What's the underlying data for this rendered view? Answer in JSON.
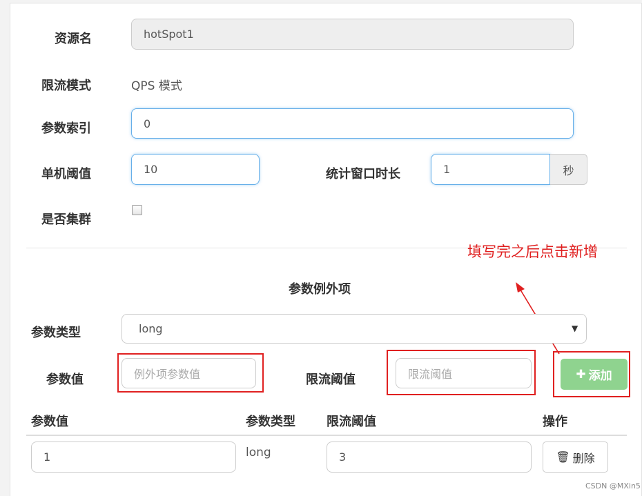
{
  "form": {
    "resource_label": "资源名",
    "resource_value": "hotSpot1",
    "limit_mode_label": "限流模式",
    "limit_mode_value": "QPS 模式",
    "param_index_label": "参数索引",
    "param_index_value": "0",
    "single_threshold_label": "单机阈值",
    "single_threshold_value": "10",
    "window_label": "统计窗口时长",
    "window_value": "1",
    "window_unit": "秒",
    "cluster_label": "是否集群"
  },
  "exceptions": {
    "section_title": "参数例外项",
    "param_type_label": "参数类型",
    "param_type_value": "long",
    "param_value_label": "参数值",
    "param_value_placeholder": "例外项参数值",
    "threshold_label": "限流阈值",
    "threshold_placeholder": "限流阈值",
    "add_button": "添加",
    "add_icon": "plus-icon"
  },
  "annotation": "填写完之后点击新增",
  "table": {
    "headers": [
      "参数值",
      "参数类型",
      "限流阈值",
      "操作"
    ],
    "rows": [
      {
        "param_value": "1",
        "param_type": "long",
        "threshold": "3",
        "action": "删除"
      }
    ]
  },
  "watermark": "CSDN @MXin5",
  "colors": {
    "annotation_red": "#e02020",
    "add_button_green": "#8fd38f",
    "focus_blue": "#66afe9"
  }
}
